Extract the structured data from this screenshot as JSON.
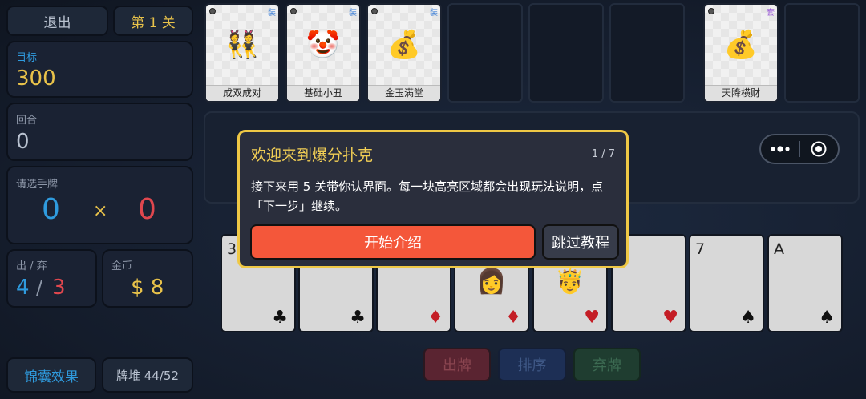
{
  "top": {
    "exit_label": "退出",
    "level_label": "第 1 关"
  },
  "stats": {
    "target_label": "目标",
    "target_value": "300",
    "round_label": "回合",
    "round_value": "0",
    "select_label": "请选手牌",
    "chips_value": "0",
    "times_sign": "×",
    "mult_value": "0",
    "play_discard_label": "出 / 弃",
    "plays_left": "4",
    "slash": "/",
    "discards_left": "3",
    "coins_label": "金币",
    "coins_value": "$ 8"
  },
  "bottom_left": {
    "bag_effects_label": "锦囊效果",
    "deck_label": "牌堆 44/52"
  },
  "jokers": [
    {
      "name": "成双成对",
      "tag": "装",
      "icon": "dancers-emoji",
      "glyph": "👯"
    },
    {
      "name": "基础小丑",
      "tag": "装",
      "icon": "joker-emoji",
      "glyph": "🤡"
    },
    {
      "name": "金玉满堂",
      "tag": "装",
      "icon": "money-bag-emoji",
      "glyph": "💰"
    },
    {
      "name": "天降横财",
      "tag": "套",
      "icon": "money-bag-emoji",
      "glyph": "💰"
    }
  ],
  "hand": [
    {
      "rank": "3",
      "suit": "♣",
      "face": ""
    },
    {
      "rank": "",
      "suit": "♣",
      "face": ""
    },
    {
      "rank": "",
      "suit": "♦",
      "face": ""
    },
    {
      "rank": "",
      "suit": "♦",
      "face": "👩"
    },
    {
      "rank": "",
      "suit": "♥",
      "face": "🤴"
    },
    {
      "rank": "",
      "suit": "♥",
      "face": ""
    },
    {
      "rank": "7",
      "suit": "♠",
      "face": ""
    },
    {
      "rank": "A",
      "suit": "♠",
      "face": ""
    }
  ],
  "actions": {
    "play_label": "出牌",
    "sort_label": "排序",
    "discard_label": "弃牌"
  },
  "tutorial": {
    "title": "欢迎来到爆分扑克",
    "pager": "1 / 7",
    "body": "接下来用 5 关带你认界面。每一块高亮区域都会出现玩法说明，点「下一步」继续。",
    "start_label": "开始介绍",
    "skip_label": "跳过教程"
  },
  "mini_program": {
    "more_icon": "more-dots-icon",
    "close_icon": "target-close-icon"
  },
  "colors": {
    "chips": "#2f9bde",
    "mult": "#e0474e",
    "gold": "#e8c24a",
    "play_btn": "#c9353b",
    "sort_btn": "#2a5db0",
    "discard_btn": "#2f8a4a"
  }
}
